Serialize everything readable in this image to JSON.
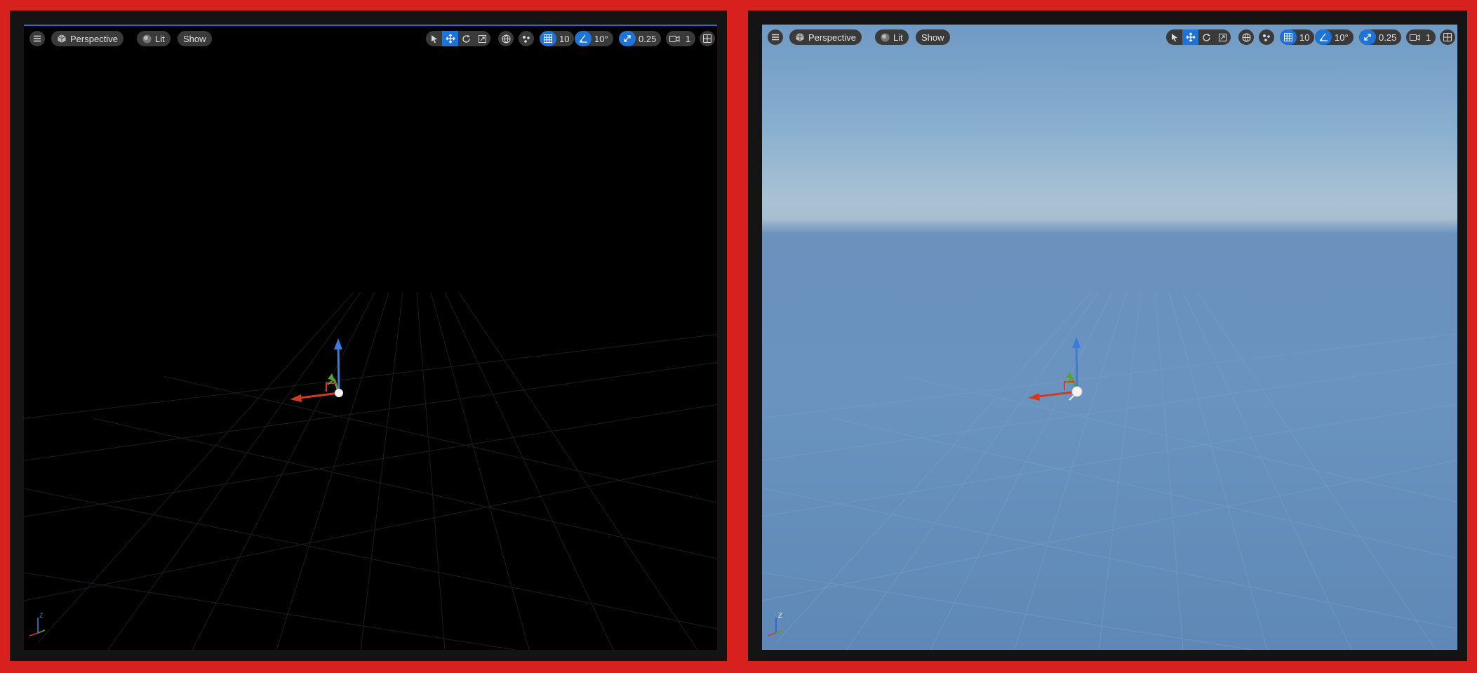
{
  "viewports": [
    {
      "id": "left",
      "view_mode": "Perspective",
      "lighting": "Lit",
      "show_label": "Show",
      "grid_snap": "10",
      "rotation_snap": "10°",
      "scale_snap": "0.25",
      "camera_speed": "1",
      "background": "black"
    },
    {
      "id": "right",
      "view_mode": "Perspective",
      "lighting": "Lit",
      "show_label": "Show",
      "grid_snap": "10",
      "rotation_snap": "10°",
      "scale_snap": "0.25",
      "camera_speed": "1",
      "background": "sky"
    }
  ],
  "axis_indicator": {
    "z_label": "Z"
  },
  "colors": {
    "border": "#d8201e",
    "accent": "#1e74d6",
    "x_axis": "#d33a1e",
    "y_axis": "#5aa02c",
    "z_axis": "#3a7be0"
  },
  "icons": [
    "hamburger-menu-icon",
    "perspective-cube-icon",
    "lit-sphere-icon",
    "select-cursor-icon",
    "translate-arrows-icon",
    "rotate-icon",
    "scale-icon",
    "world-globe-icon",
    "surface-snap-icon",
    "grid-snap-icon",
    "rotation-snap-icon",
    "scale-snap-icon",
    "camera-speed-icon",
    "maximize-layout-icon"
  ]
}
